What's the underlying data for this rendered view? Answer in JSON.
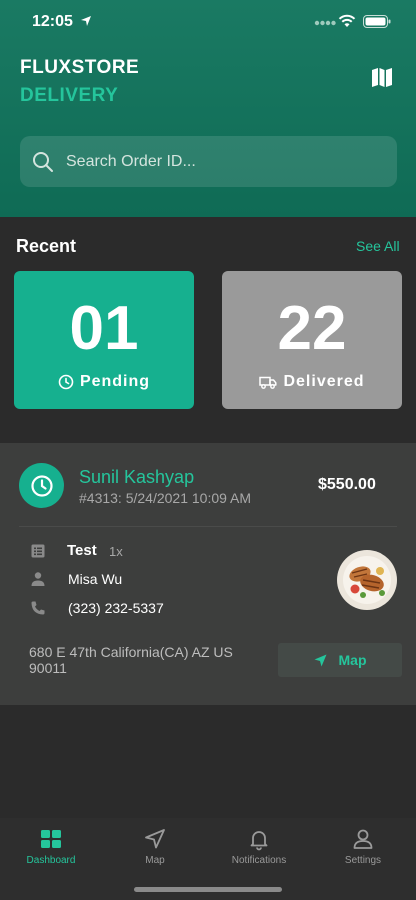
{
  "status_bar": {
    "time": "12:05"
  },
  "header": {
    "brand": "FLUXSTORE",
    "brand_sub": "DELIVERY"
  },
  "search": {
    "placeholder": "Search Order ID..."
  },
  "recent": {
    "title": "Recent",
    "see_all": "See All",
    "stats": [
      {
        "value": "01",
        "label": "Pending",
        "color": "#16b08f"
      },
      {
        "value": "22",
        "label": "Delivered",
        "color": "#9a9a9a"
      }
    ]
  },
  "order": {
    "customer": "Sunil Kashyap",
    "meta": "#4313: 5/24/2021 10:09 AM",
    "total": "$550.00",
    "item_name": "Test",
    "item_qty": "1x",
    "receiver": "Misa Wu",
    "phone": "(323) 232-5337",
    "address": "680 E 47th California(CA) AZ US 90011",
    "map_label": "Map"
  },
  "tabs": [
    {
      "label": "Dashboard",
      "icon": "dashboard-icon"
    },
    {
      "label": "Map",
      "icon": "navigation-icon"
    },
    {
      "label": "Notifications",
      "icon": "bell-icon"
    },
    {
      "label": "Settings",
      "icon": "user-icon"
    }
  ],
  "colors": {
    "accent": "#25c59c",
    "header": "#0f6b55",
    "background": "#2b2b2b",
    "card": "#3d3e3d"
  }
}
